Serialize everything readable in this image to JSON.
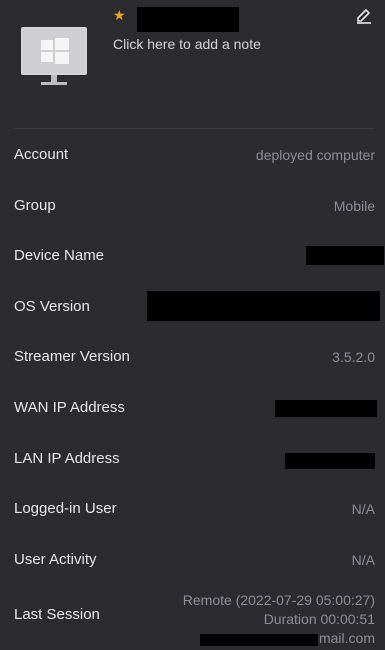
{
  "header": {
    "note_link": "Click here to add a note"
  },
  "details": {
    "account": {
      "label": "Account",
      "value": "deployed computer"
    },
    "group": {
      "label": "Group",
      "value": "Mobile"
    },
    "device_name": {
      "label": "Device Name"
    },
    "os_version": {
      "label": "OS Version"
    },
    "streamer_version": {
      "label": "Streamer Version",
      "value": "3.5.2.0"
    },
    "wan_ip": {
      "label": "WAN IP Address"
    },
    "lan_ip": {
      "label": "LAN IP Address"
    },
    "logged_in_user": {
      "label": "Logged-in User",
      "value": "N/A"
    },
    "user_activity": {
      "label": "User Activity",
      "value": "N/A"
    },
    "last_session": {
      "label": "Last Session",
      "line1": "Remote (2022-07-29 05:00:27)",
      "line2": "Duration 00:00:51",
      "email_suffix": "mail.com"
    }
  },
  "colors": {
    "background": "#2c2b30",
    "star": "#f2a71b",
    "value_text": "#8f8e94"
  },
  "icons": [
    "windows-monitor-icon",
    "star-icon",
    "edit-icon"
  ]
}
